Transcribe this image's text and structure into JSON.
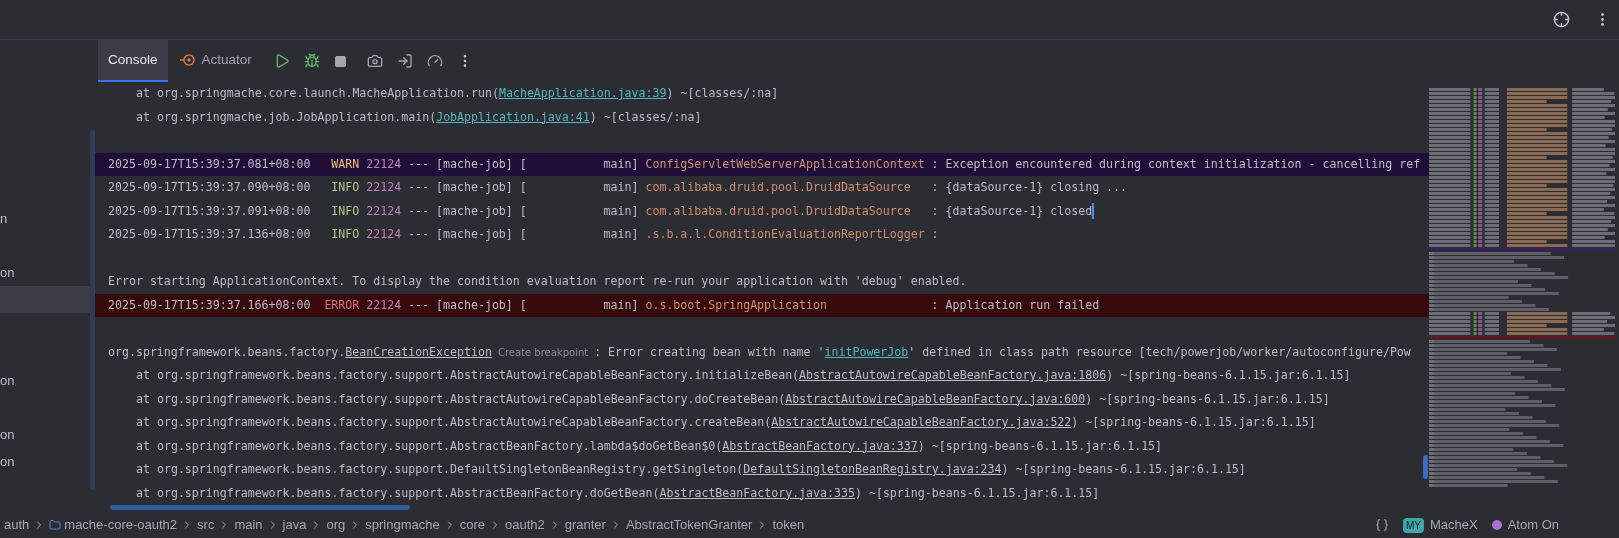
{
  "toolbar": {
    "tabs": [
      {
        "label": "Console",
        "selected": true
      },
      {
        "label": "Actuator",
        "selected": false
      }
    ]
  },
  "sidebar": {
    "items": [
      {
        "text": "n",
        "selected": false
      },
      {
        "text": "on",
        "selected": false
      },
      {
        "selected": true
      },
      {
        "text": "on",
        "selected": false
      },
      {
        "text": "on",
        "selected": false
      },
      {
        "text": "on",
        "selected": false
      }
    ]
  },
  "console": {
    "lines": [
      {
        "kind": "stack",
        "library": false,
        "method": "at org.springmache.core.launch.MacheApplication.run(",
        "link": "MacheApplication.java:39",
        "suffix": ") ~[classes/:na]"
      },
      {
        "kind": "stack",
        "library": false,
        "method": "at org.springmache.job.JobApplication.main(",
        "link": "JobApplication.java:41",
        "suffix": ") ~[classes/:na]"
      },
      {
        "kind": "blank"
      },
      {
        "kind": "log",
        "level": "WARN",
        "timestamp": "2025-09-17T15:39:37.081+08:00",
        "pid": "22124",
        "thread": "--- [mache-job] [           main]",
        "logger": "ConfigServletWebServerApplicationContext",
        "message": ": Exception encountered during context initialization - cancelling ref",
        "caret": false
      },
      {
        "kind": "log",
        "level": "INFO",
        "timestamp": "2025-09-17T15:39:37.090+08:00",
        "pid": "22124",
        "thread": "--- [mache-job] [           main]",
        "logger": "com.alibaba.druid.pool.DruidDataSource",
        "message": ": {dataSource-1} closing ...",
        "caret": false
      },
      {
        "kind": "log",
        "level": "INFO",
        "timestamp": "2025-09-17T15:39:37.091+08:00",
        "pid": "22124",
        "thread": "--- [mache-job] [           main]",
        "logger": "com.alibaba.druid.pool.DruidDataSource",
        "message": ": {dataSource-1} closed",
        "caret": true
      },
      {
        "kind": "log",
        "level": "INFO",
        "timestamp": "2025-09-17T15:39:37.136+08:00",
        "pid": "22124",
        "thread": "--- [mache-job] [           main]",
        "logger": ".s.b.a.l.ConditionEvaluationReportLogger",
        "message": ":",
        "caret": false
      },
      {
        "kind": "blank"
      },
      {
        "kind": "plain",
        "text": "Error starting ApplicationContext. To display the condition evaluation report re-run your application with 'debug' enabled."
      },
      {
        "kind": "log",
        "level": "ERROR",
        "timestamp": "2025-09-17T15:39:37.166+08:00",
        "pid": "22124",
        "thread": "--- [mache-job] [           main]",
        "logger": "o.s.boot.SpringApplication",
        "message": ": Application run failed",
        "caret": false
      },
      {
        "kind": "blank"
      },
      {
        "kind": "exception",
        "package": "org.springframework.beans.factory.",
        "class_link": "BeanCreationException",
        "hint": "Create breakpoint",
        "message_start": ": Error creating bean with name '",
        "bean_link": "initPowerJob",
        "message_end": "' defined in class path resource [tech/powerjob/worker/autoconfigure/Pow"
      },
      {
        "kind": "stack",
        "library": true,
        "method": "at org.springframework.beans.factory.support.AbstractAutowireCapableBeanFactory.initializeBean(",
        "link": "AbstractAutowireCapableBeanFactory.java:1806",
        "suffix": ") ~[spring-beans-6.1.15.jar:6.1.15]"
      },
      {
        "kind": "stack",
        "library": true,
        "method": "at org.springframework.beans.factory.support.AbstractAutowireCapableBeanFactory.doCreateBean(",
        "link": "AbstractAutowireCapableBeanFactory.java:600",
        "suffix": ") ~[spring-beans-6.1.15.jar:6.1.15]"
      },
      {
        "kind": "stack",
        "library": true,
        "method": "at org.springframework.beans.factory.support.AbstractAutowireCapableBeanFactory.createBean(",
        "link": "AbstractAutowireCapableBeanFactory.java:522",
        "suffix": ") ~[spring-beans-6.1.15.jar:6.1.15]"
      },
      {
        "kind": "stack",
        "library": true,
        "method": "at org.springframework.beans.factory.support.AbstractBeanFactory.lambda$doGetBean$0(",
        "link": "AbstractBeanFactory.java:337",
        "suffix": ") ~[spring-beans-6.1.15.jar:6.1.15]"
      },
      {
        "kind": "stack",
        "library": true,
        "method": "at org.springframework.beans.factory.support.DefaultSingletonBeanRegistry.getSingleton(",
        "link": "DefaultSingletonBeanRegistry.java:234",
        "suffix": ") ~[spring-beans-6.1.15.jar:6.1.15]"
      },
      {
        "kind": "stack",
        "library": true,
        "method": "at org.springframework.beans.factory.support.AbstractBeanFactory.doGetBean(",
        "link": "AbstractBeanFactory.java:335",
        "suffix": ") ~[spring-beans-6.1.15.jar:6.1.15]"
      }
    ]
  },
  "status_bar": {
    "breadcrumbs": [
      "auth",
      "mache-core-oauth2",
      "src",
      "main",
      "java",
      "org",
      "springmache",
      "core",
      "oauth2",
      "granter",
      "AbstractTokenGranter",
      "token"
    ],
    "widgets": [
      {
        "badge": "MY",
        "label": "MacheX"
      },
      {
        "label": "Atom On"
      }
    ]
  }
}
